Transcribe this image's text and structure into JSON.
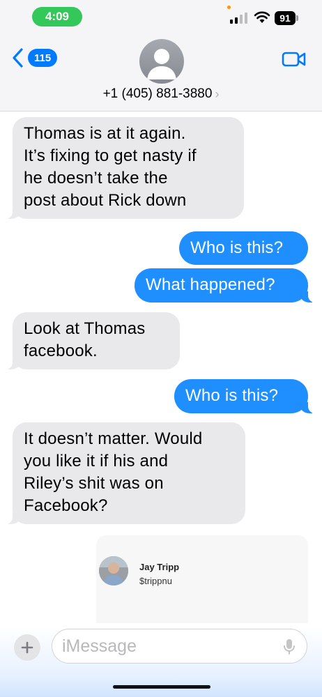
{
  "status_bar": {
    "time": "4:09",
    "battery": "91",
    "colors": {
      "time_pill": "#34c759",
      "mic_dot": "#ff9500"
    }
  },
  "header": {
    "back_badge": "115",
    "contact": "+1 (405) 881-3880",
    "chevron": "›",
    "icons": [
      "back-chevron-icon",
      "contact-avatar",
      "video-call-icon"
    ]
  },
  "messages": [
    {
      "dir": "in",
      "text": "Thomas is at it again.\nIt’s fixing to get nasty if\nhe doesn’t take the\npost about Rick down"
    },
    {
      "dir": "out",
      "text": "Who is this?"
    },
    {
      "dir": "out",
      "text": "What happened?"
    },
    {
      "dir": "in",
      "text": "Look at Thomas\nfacebook."
    },
    {
      "dir": "out",
      "text": "Who is this?"
    },
    {
      "dir": "in",
      "text": "It doesn’t matter. Would\nyou like it if his and\nRiley’s shit was on\nFacebook?"
    }
  ],
  "payment_card": {
    "name": "Jay Tripp",
    "handle": "$trippnu"
  },
  "composer": {
    "plus": "+",
    "placeholder": "iMessage",
    "icons": [
      "plus-icon",
      "microphone-icon"
    ]
  },
  "colors": {
    "outgoing": "#1f8fff",
    "incoming": "#e9e9eb",
    "accent": "#007aff"
  }
}
